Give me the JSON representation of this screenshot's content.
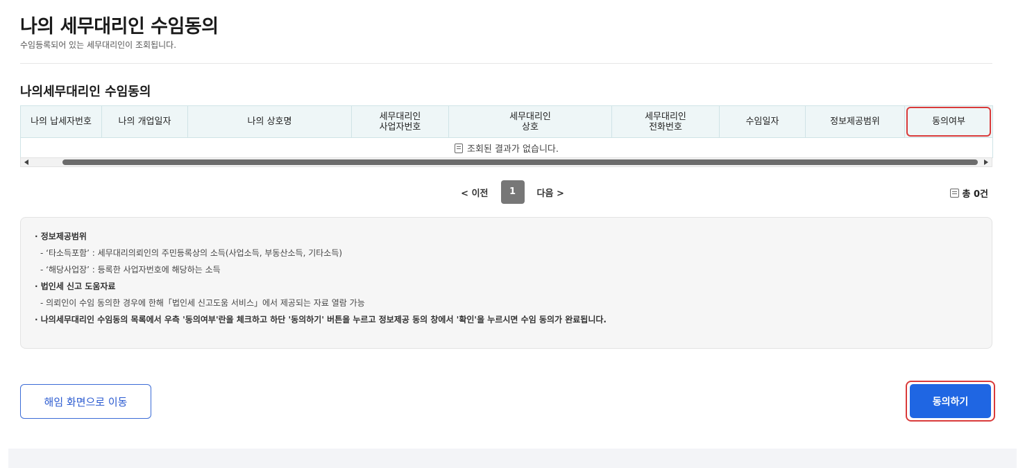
{
  "page": {
    "title": "나의 세무대리인 수임동의",
    "subtitle": "수임등록되어 있는 세무대리인이 조회됩니다."
  },
  "section": {
    "title": "나의세무대리인 수임동의"
  },
  "table": {
    "columns": [
      {
        "line1": "나의 납세자번호",
        "line2": ""
      },
      {
        "line1": "나의 개업일자",
        "line2": ""
      },
      {
        "line1": "나의 상호명",
        "line2": ""
      },
      {
        "line1": "세무대리인",
        "line2": "사업자번호"
      },
      {
        "line1": "세무대리인",
        "line2": "상호"
      },
      {
        "line1": "세무대리인",
        "line2": "전화번호"
      },
      {
        "line1": "수임일자",
        "line2": ""
      },
      {
        "line1": "정보제공범위",
        "line2": ""
      },
      {
        "line1": "동의여부",
        "line2": ""
      }
    ],
    "empty_message": "조회된 결과가 없습니다."
  },
  "pagination": {
    "prev_label": "< 이전",
    "current_page": "1",
    "next_label": "다음 >",
    "total_label": "총 0건"
  },
  "info": {
    "items": [
      {
        "text": "· 정보제공범위",
        "bold": true
      },
      {
        "text": "- ‘타소득포함’ : 세무대리의뢰인의 주민등록상의 소득(사업소득, 부동산소득, 기타소득)",
        "bold": false
      },
      {
        "text": "- ‘해당사업장’ : 등록한 사업자번호에 해당하는 소득",
        "bold": false
      },
      {
        "text": "· 법인세 신고 도움자료",
        "bold": true
      },
      {
        "text": "- 의뢰인이 수임 동의한 경우에 한해「법인세 신고도움 서비스」에서 제공되는 자료 열람 가능",
        "bold": false
      },
      {
        "text": "· 나의세무대리인 수임동의 목록에서 우측 '동의여부'란을 체크하고 하단 '동의하기' 버튼을 누르고 정보제공 동의 창에서 '확인'을 누르시면 수임 동의가 완료됩니다.",
        "bold": true
      }
    ]
  },
  "buttons": {
    "dismiss_label": "해임 화면으로 이동",
    "agree_label": "동의하기"
  },
  "colors": {
    "primary": "#1f66e3",
    "highlight": "#d93a3a",
    "table_header_bg": "#eef6f7"
  }
}
